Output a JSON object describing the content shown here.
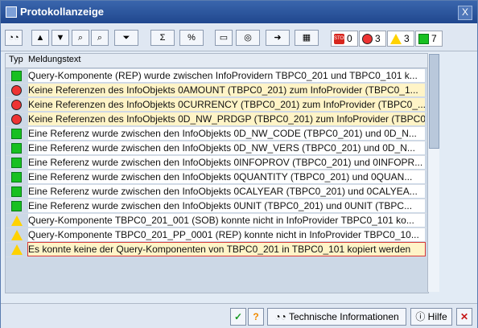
{
  "window": {
    "title": "Protokollanzeige",
    "close_label": "X"
  },
  "toolbar": {
    "counters": {
      "stop": "0",
      "red": "3",
      "warning": "3",
      "green": "7"
    }
  },
  "table": {
    "headers": [
      "Typ",
      "Meldungstext"
    ],
    "rows": [
      {
        "type": "green",
        "text": "Query-Komponente (REP) wurde zwischen InfoProvidern TBPC0_201 und TBPC0_101 k..."
      },
      {
        "type": "red",
        "text": "Keine Referenzen des InfoObjekts 0AMOUNT (TBPC0_201) zum InfoProvider (TBPC0_1..."
      },
      {
        "type": "red",
        "text": "Keine Referenzen des InfoObjekts 0CURRENCY (TBPC0_201) zum InfoProvider (TBPC0_..."
      },
      {
        "type": "red",
        "text": "Keine Referenzen des InfoObjekts 0D_NW_PRDGP (TBPC0_201) zum InfoProvider (TBPC0..."
      },
      {
        "type": "green",
        "text": "Eine Referenz wurde zwischen den InfoObjekts 0D_NW_CODE (TBPC0_201) und 0D_N..."
      },
      {
        "type": "green",
        "text": "Eine Referenz wurde zwischen den InfoObjekts 0D_NW_VERS (TBPC0_201) und 0D_N..."
      },
      {
        "type": "green",
        "text": "Eine Referenz wurde zwischen den InfoObjekts 0INFOPROV (TBPC0_201) und 0INFOPR..."
      },
      {
        "type": "green",
        "text": "Eine Referenz wurde zwischen den InfoObjekts 0QUANTITY (TBPC0_201) und 0QUAN..."
      },
      {
        "type": "green",
        "text": "Eine Referenz wurde zwischen den InfoObjekts 0CALYEAR (TBPC0_201) und 0CALYEA..."
      },
      {
        "type": "green",
        "text": "Eine Referenz wurde zwischen den InfoObjekts 0UNIT (TBPC0_201) und 0UNIT (TBPC..."
      },
      {
        "type": "warning",
        "text": "Query-Komponente TBPC0_201_001 (SOB) konnte nicht in InfoProvider TBPC0_101 ko..."
      },
      {
        "type": "warning",
        "text": "Query-Komponente TBPC0_201_PP_0001 (REP) konnte nicht in InfoProvider TBPC0_10..."
      },
      {
        "type": "warning",
        "text": "Es konnte keine der Query-Komponenten von TBPC0_201 in TBPC0_101 kopiert werden"
      }
    ]
  },
  "footer": {
    "technical_info_label": "Technische Informationen",
    "help_label": "Hilfe"
  },
  "colors": {
    "title_bar": "#2f5aa3",
    "green_status": "#18c021",
    "red_status": "#e33333",
    "warning_status": "#ffd200"
  }
}
